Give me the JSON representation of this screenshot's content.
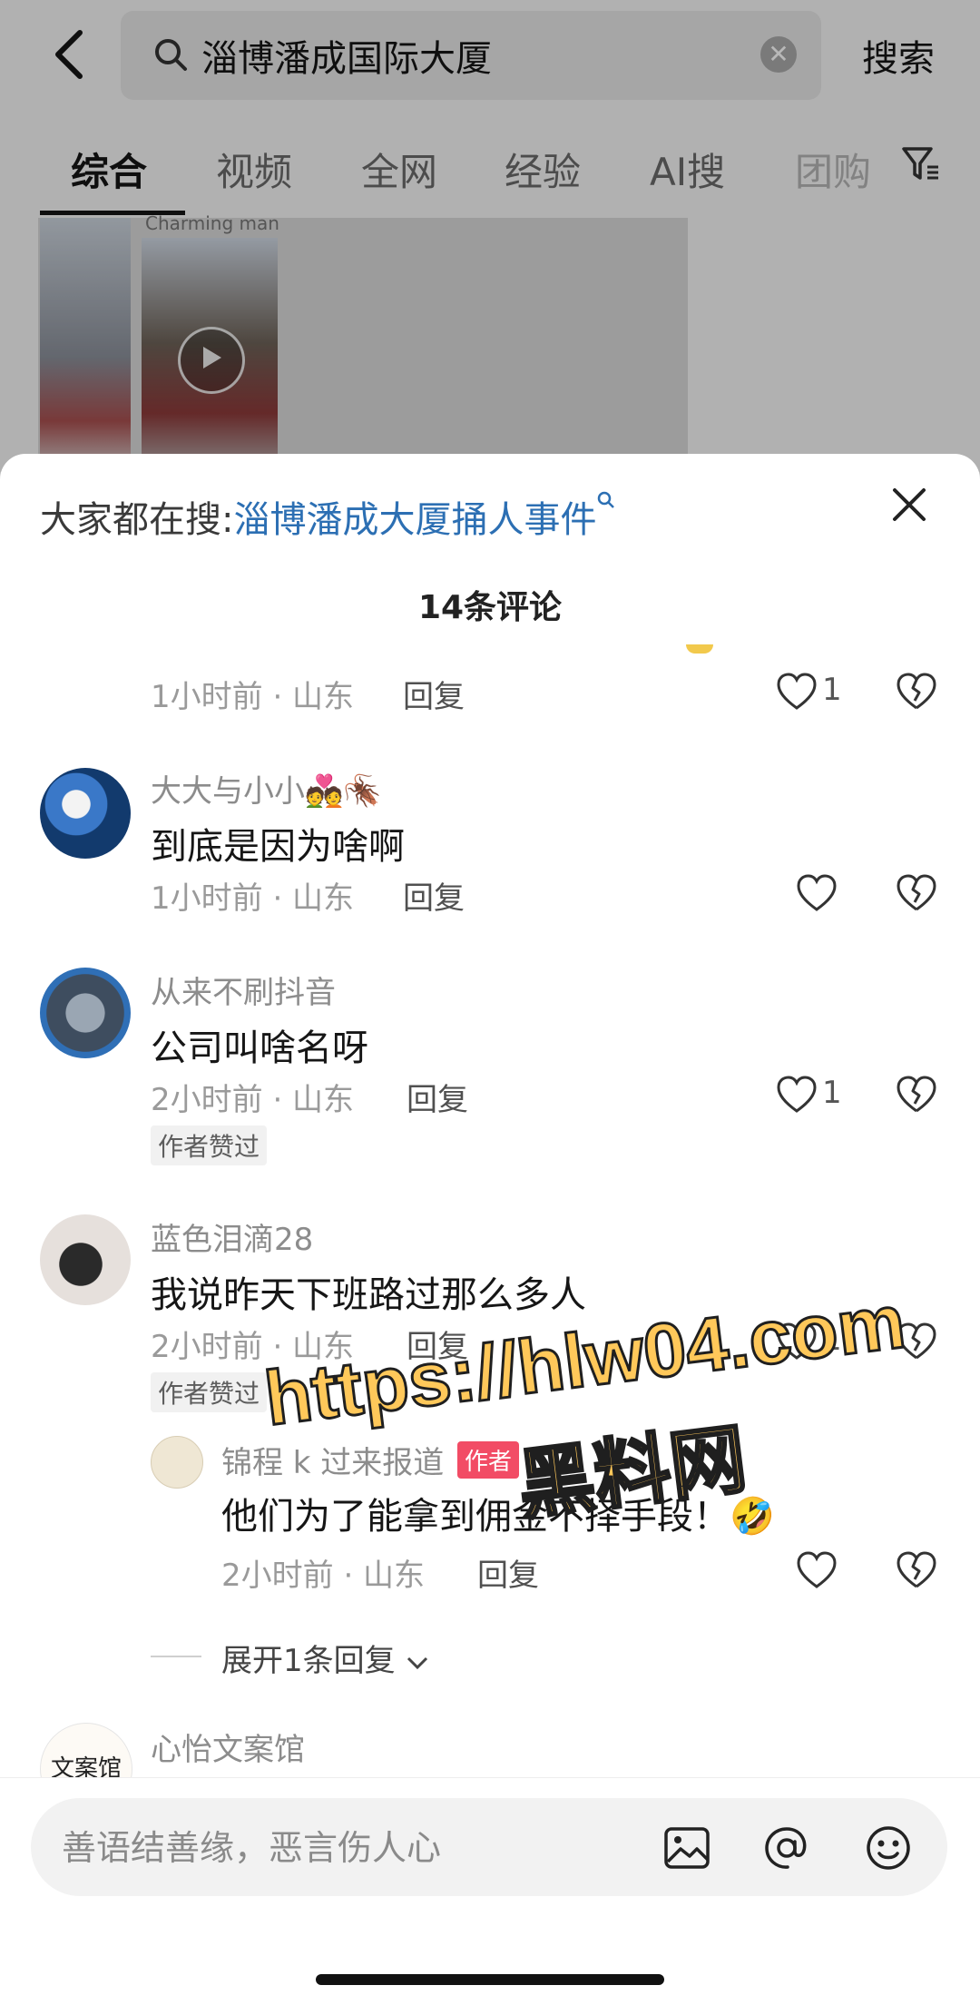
{
  "search": {
    "query": "淄博潘成国际大厦",
    "submit_label": "搜索"
  },
  "tabs": [
    {
      "label": "综合",
      "active": true
    },
    {
      "label": "视频",
      "active": false
    },
    {
      "label": "全网",
      "active": false
    },
    {
      "label": "经验",
      "active": false
    },
    {
      "label": "AI搜",
      "active": false
    },
    {
      "label": "团购",
      "active": false
    }
  ],
  "background_video": {
    "caption": "Charming man"
  },
  "sheet": {
    "hot_search_label": "大家都在搜:",
    "hot_search_link": "淄博潘成大厦捅人事件",
    "comment_count": "14条评论"
  },
  "comments": [
    {
      "meta": "1小时前 · 山东",
      "reply_label": "回复",
      "likes": "1"
    },
    {
      "username": "大大与小小💑🪳",
      "text": "到底是因为啥啊",
      "meta": "1小时前 · 山东",
      "reply_label": "回复",
      "likes": ""
    },
    {
      "username": "从来不刷抖音",
      "text": "公司叫啥名呀",
      "meta": "2小时前 · 山东",
      "reply_label": "回复",
      "likes": "1",
      "tag": "作者赞过"
    },
    {
      "username": "蓝色泪滴28",
      "text": "我说昨天下班路过那么多人",
      "meta": "2小时前 · 山东",
      "reply_label": "回复",
      "likes": "1",
      "tag": "作者赞过"
    }
  ],
  "reply": {
    "username": "锦程 k 过来报道",
    "badge": "作者",
    "text": "他们为了能拿到佣金不择手段！🤣",
    "meta": "2小时前 · 山东",
    "reply_label": "回复"
  },
  "expand_label": "展开1条回复",
  "partial_comment": {
    "username": "心怡文案馆",
    "avatar_text": "文案馆"
  },
  "watermark": {
    "url": "https://hlw04.com",
    "name": "黑料网"
  },
  "input": {
    "placeholder": "善语结善缘，恶言伤人心"
  },
  "colors": {
    "link": "#2c6fb3",
    "author_badge": "#f24c65",
    "watermark_fill": "#ffc85a"
  }
}
